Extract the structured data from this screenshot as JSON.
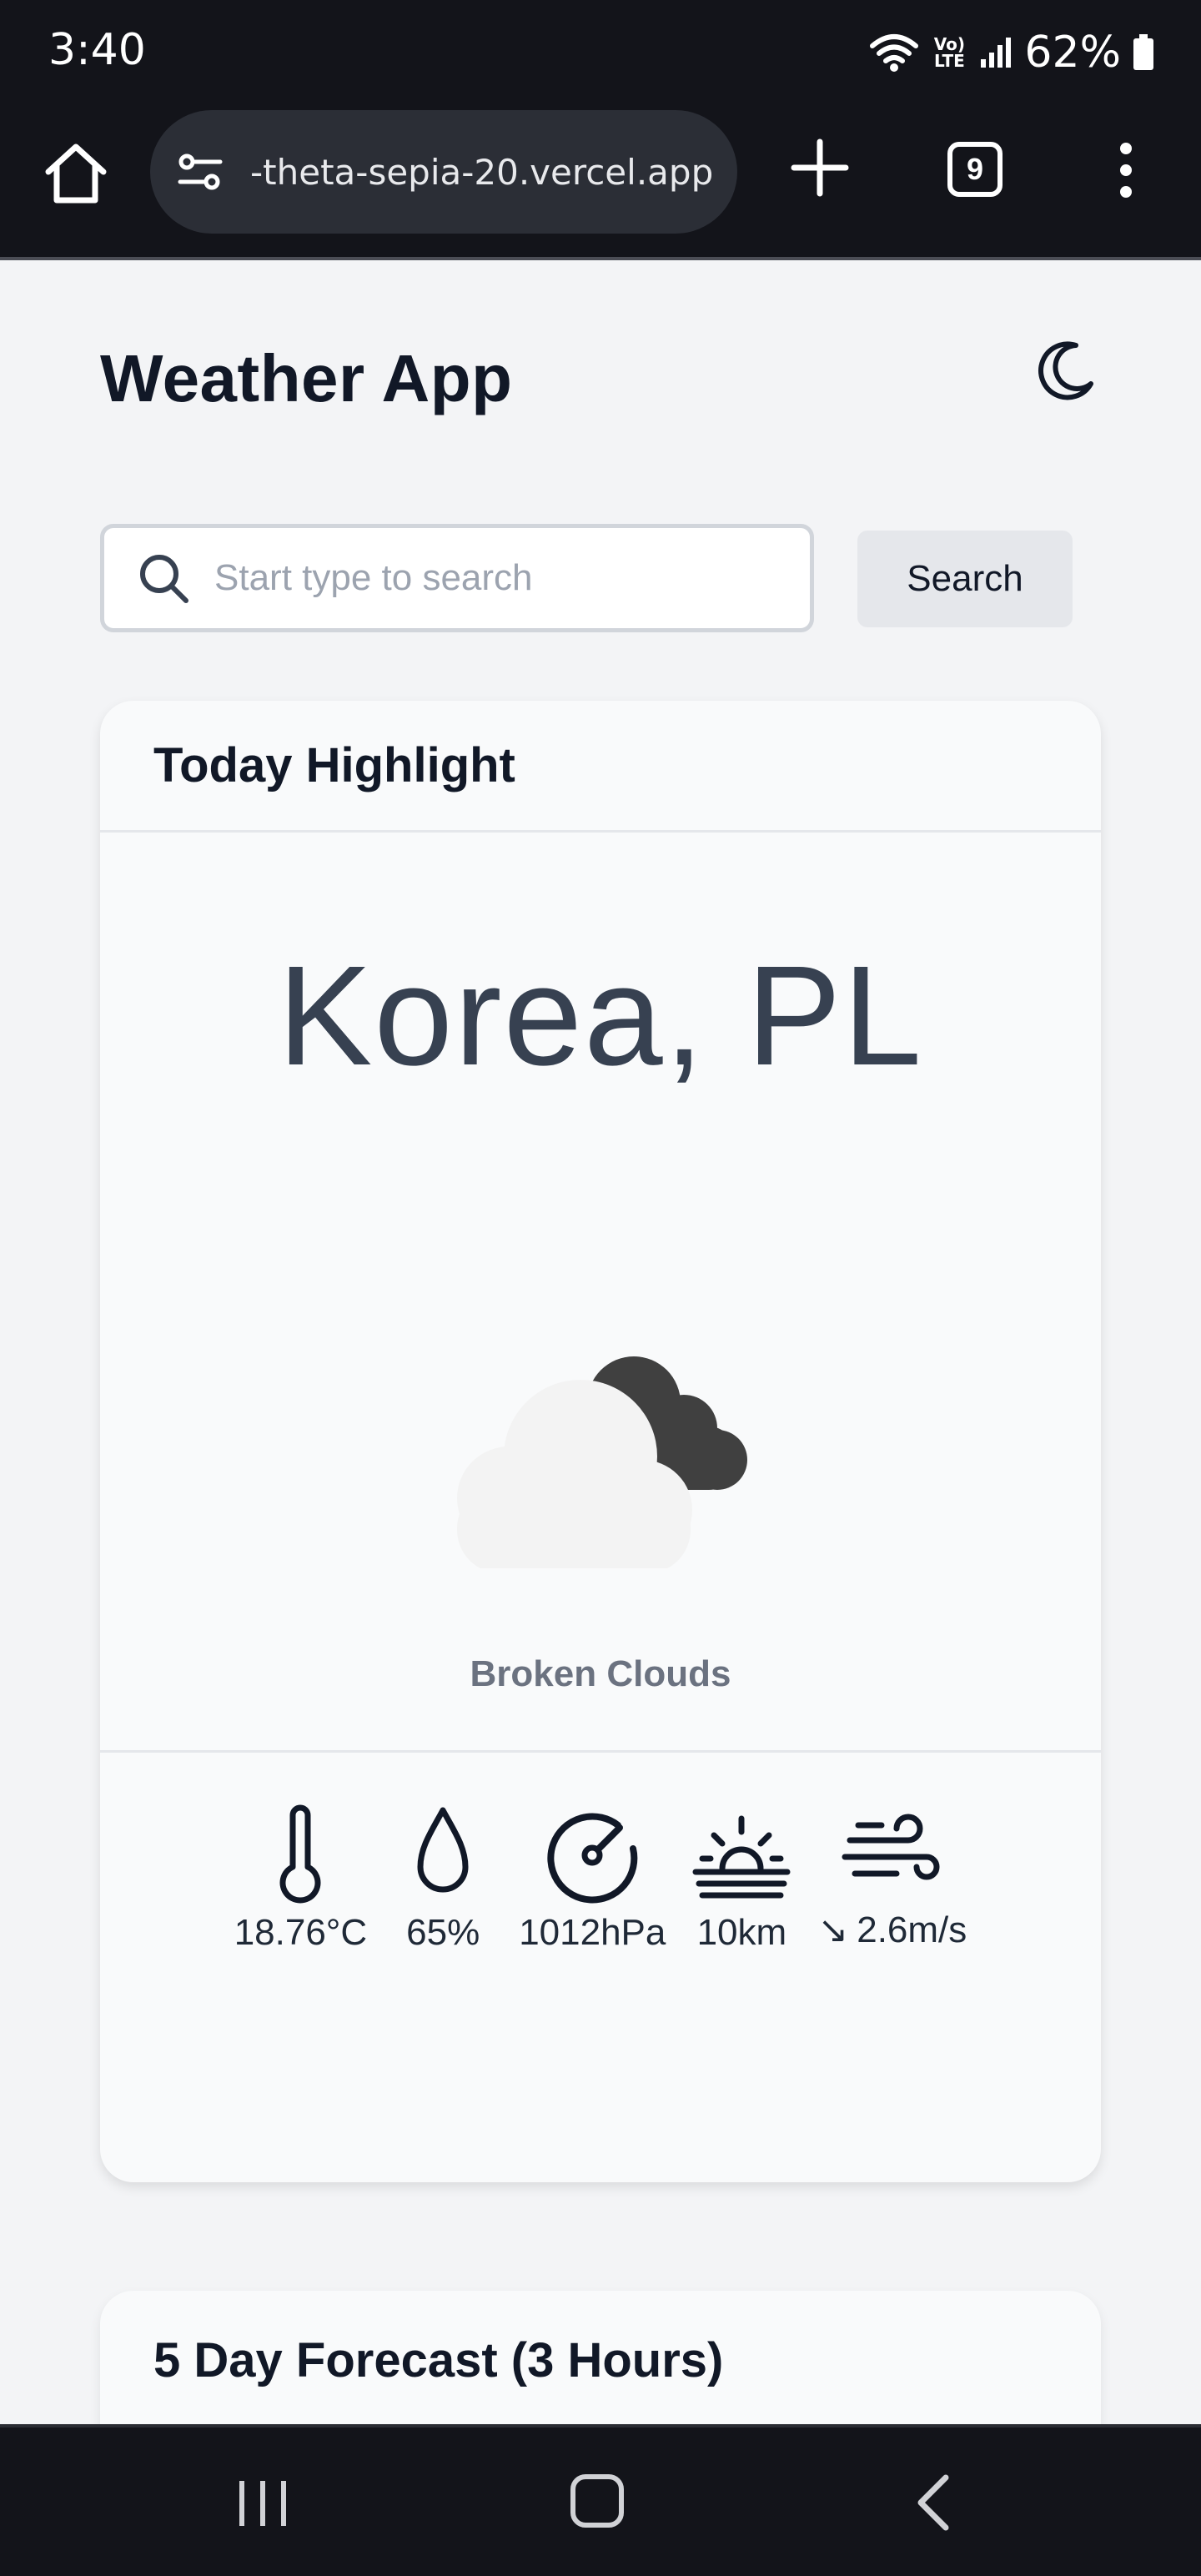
{
  "status_bar": {
    "time": "3:40",
    "network_label": "Vo) LTE",
    "battery": "62%"
  },
  "browser": {
    "url": "-theta-sepia-20.vercel.app",
    "tab_count": "9"
  },
  "app": {
    "title": "Weather App",
    "theme_toggle_icon": "moon-icon"
  },
  "search": {
    "placeholder": "Start type to search",
    "value": "",
    "button_label": "Search"
  },
  "highlight": {
    "heading": "Today Highlight",
    "location": "Korea, PL",
    "condition": "Broken Clouds",
    "weather_icon": "broken-clouds-icon",
    "stats": {
      "temperature": "18.76°C",
      "humidity": "65%",
      "pressure": "1012hPa",
      "visibility": "10km",
      "wind_direction_arrow": "↘",
      "wind_speed": "2.6m/s"
    }
  },
  "forecast": {
    "heading": "5 Day Forecast (3 Hours)"
  },
  "colors": {
    "background": "#f3f4f6",
    "card": "#f9fafb",
    "system_bars": "#13141a",
    "text_primary": "#111827",
    "text_muted": "#6b7280"
  }
}
